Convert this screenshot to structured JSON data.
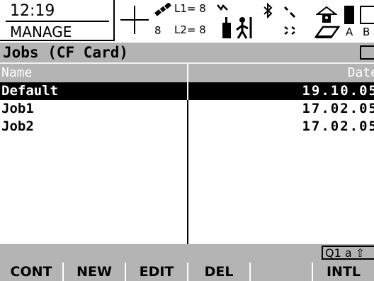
{
  "status": {
    "time": "12:19",
    "mode": "MANAGE",
    "satellites": "8",
    "l1_label": "L1= 8",
    "l2_label": "L2= 8",
    "battery_a_label": "A",
    "battery_b_label": "B",
    "icons": [
      "crosshair-icon",
      "satellite-icon",
      "signal-icon",
      "rover-icon",
      "bluetooth-icon",
      "radio-icon",
      "lock-icon",
      "cf-card-icon",
      "battery-icon"
    ]
  },
  "window": {
    "title": "Jobs (CF Card)",
    "close_icon": "close-icon"
  },
  "table": {
    "columns": {
      "name": "Name",
      "date": "Date"
    },
    "rows": [
      {
        "name": "Default",
        "date": "19.10.05",
        "selected": true
      },
      {
        "name": "Job1",
        "date": "17.02.05",
        "selected": false
      },
      {
        "name": "Job2",
        "date": "17.02.05",
        "selected": false
      }
    ]
  },
  "input_mode": "Q1 a ⇧",
  "fkeys": [
    "CONT",
    "NEW",
    "EDIT",
    "DEL",
    "",
    "INTL"
  ]
}
